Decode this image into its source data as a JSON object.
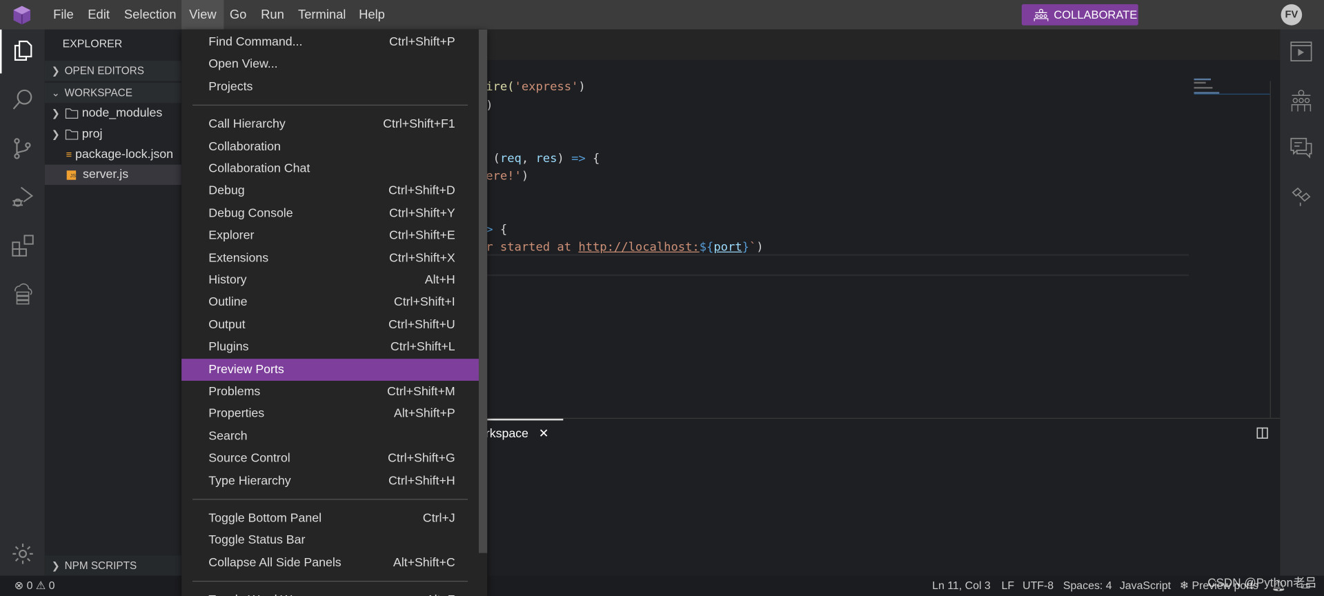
{
  "titlebar": {
    "menus": [
      "File",
      "Edit",
      "Selection",
      "View",
      "Go",
      "Run",
      "Terminal",
      "Help"
    ],
    "active_menu": "View",
    "collaborate_label": "COLLABORATE",
    "avatar_initials": "FV",
    "accent_color": "#7e3f9c"
  },
  "sidebar": {
    "title": "EXPLORER",
    "open_editors": "OPEN EDITORS",
    "workspace": "WORKSPACE",
    "items": [
      {
        "label": "node_modules",
        "type": "folder"
      },
      {
        "label": "proj",
        "type": "folder"
      },
      {
        "label": "package-lock.json",
        "type": "json-file"
      },
      {
        "label": "server.js",
        "type": "js-file",
        "selected": true
      }
    ],
    "npm_scripts": "NPM SCRIPTS"
  },
  "editor": {
    "lines": [
      {
        "a": "uire(",
        "b": "'express'",
        "c": ")"
      },
      {
        "a": "()"
      },
      {
        "a": ", (",
        "v1": "req",
        "a2": ", ",
        "v2": "res",
        "a3": ") ",
        "k": "=>",
        "a4": " {"
      },
      {
        "s": "here!'",
        "a": ")"
      },
      {
        "k": "=>",
        "a": " {"
      },
      {
        "s": "er started at ",
        "u": "http://localhost:",
        "k": "${",
        "v": "port",
        "k2": "}",
        "s2": "`",
        "a": ")"
      }
    ]
  },
  "panel": {
    "tab_label": "orkspace",
    "close": "✕"
  },
  "view_menu": {
    "groups": [
      [
        {
          "label": "Find Command...",
          "shortcut": "Ctrl+Shift+P"
        },
        {
          "label": "Open View...",
          "shortcut": ""
        },
        {
          "label": "Projects",
          "shortcut": ""
        }
      ],
      [
        {
          "label": "Call Hierarchy",
          "shortcut": "Ctrl+Shift+F1"
        },
        {
          "label": "Collaboration",
          "shortcut": ""
        },
        {
          "label": "Collaboration Chat",
          "shortcut": ""
        },
        {
          "label": "Debug",
          "shortcut": "Ctrl+Shift+D"
        },
        {
          "label": "Debug Console",
          "shortcut": "Ctrl+Shift+Y"
        },
        {
          "label": "Explorer",
          "shortcut": "Ctrl+Shift+E"
        },
        {
          "label": "Extensions",
          "shortcut": "Ctrl+Shift+X"
        },
        {
          "label": "History",
          "shortcut": "Alt+H"
        },
        {
          "label": "Outline",
          "shortcut": "Ctrl+Shift+I"
        },
        {
          "label": "Output",
          "shortcut": "Ctrl+Shift+U"
        },
        {
          "label": "Plugins",
          "shortcut": "Ctrl+Shift+L"
        },
        {
          "label": "Preview Ports",
          "shortcut": "",
          "highlighted": true
        },
        {
          "label": "Problems",
          "shortcut": "Ctrl+Shift+M"
        },
        {
          "label": "Properties",
          "shortcut": "Alt+Shift+P"
        },
        {
          "label": "Search",
          "shortcut": ""
        },
        {
          "label": "Source Control",
          "shortcut": "Ctrl+Shift+G"
        },
        {
          "label": "Type Hierarchy",
          "shortcut": "Ctrl+Shift+H"
        }
      ],
      [
        {
          "label": "Toggle Bottom Panel",
          "shortcut": "Ctrl+J"
        },
        {
          "label": "Toggle Status Bar",
          "shortcut": ""
        },
        {
          "label": "Collapse All Side Panels",
          "shortcut": "Alt+Shift+C"
        }
      ],
      [
        {
          "label": "Toggle Word Wrap",
          "shortcut": "Alt+Z"
        }
      ]
    ]
  },
  "statusbar": {
    "errors": "0",
    "warnings": "0",
    "position": "Ln 11, Col 3",
    "eol": "LF",
    "encoding": "UTF-8",
    "indent": "Spaces: 4",
    "language": "JavaScript",
    "preview_ports": "Preview ports"
  },
  "watermark": "CSDN @Python老吕"
}
